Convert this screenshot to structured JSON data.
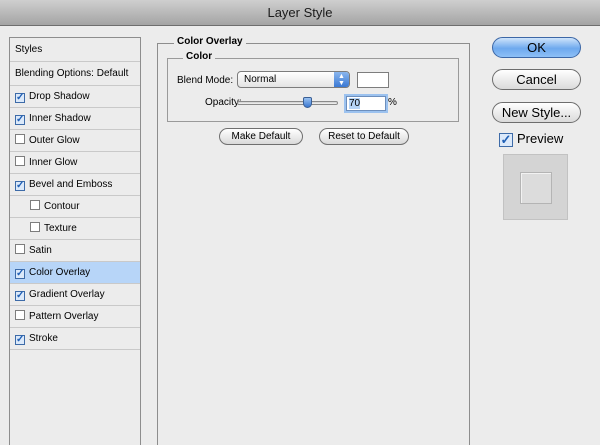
{
  "window": {
    "title": "Layer Style"
  },
  "styles_panel": {
    "header": "Styles",
    "blending": "Blending Options: Default",
    "items": [
      {
        "label": "Drop Shadow",
        "checked": true,
        "sub": false,
        "selected": false
      },
      {
        "label": "Inner Shadow",
        "checked": true,
        "sub": false,
        "selected": false
      },
      {
        "label": "Outer Glow",
        "checked": false,
        "sub": false,
        "selected": false
      },
      {
        "label": "Inner Glow",
        "checked": false,
        "sub": false,
        "selected": false
      },
      {
        "label": "Bevel and Emboss",
        "checked": true,
        "sub": false,
        "selected": false
      },
      {
        "label": "Contour",
        "checked": false,
        "sub": true,
        "selected": false
      },
      {
        "label": "Texture",
        "checked": false,
        "sub": true,
        "selected": false
      },
      {
        "label": "Satin",
        "checked": false,
        "sub": false,
        "selected": false
      },
      {
        "label": "Color Overlay",
        "checked": true,
        "sub": false,
        "selected": true
      },
      {
        "label": "Gradient Overlay",
        "checked": true,
        "sub": false,
        "selected": false
      },
      {
        "label": "Pattern Overlay",
        "checked": false,
        "sub": false,
        "selected": false
      },
      {
        "label": "Stroke",
        "checked": true,
        "sub": false,
        "selected": false
      }
    ]
  },
  "color_overlay": {
    "title": "Color Overlay",
    "group_title": "Color",
    "blend_mode_label": "Blend Mode:",
    "blend_mode_value": "Normal",
    "overlay_color": "#ffffff",
    "opacity_label": "Opacity:",
    "opacity_value": "70",
    "opacity_unit": "%",
    "make_default": "Make Default",
    "reset_default": "Reset to Default"
  },
  "buttons": {
    "ok": "OK",
    "cancel": "Cancel",
    "new_style": "New Style...",
    "preview": "Preview",
    "preview_checked": true
  },
  "colors": {
    "accent": "#3b79d4",
    "selection": "#b7d5f8"
  }
}
